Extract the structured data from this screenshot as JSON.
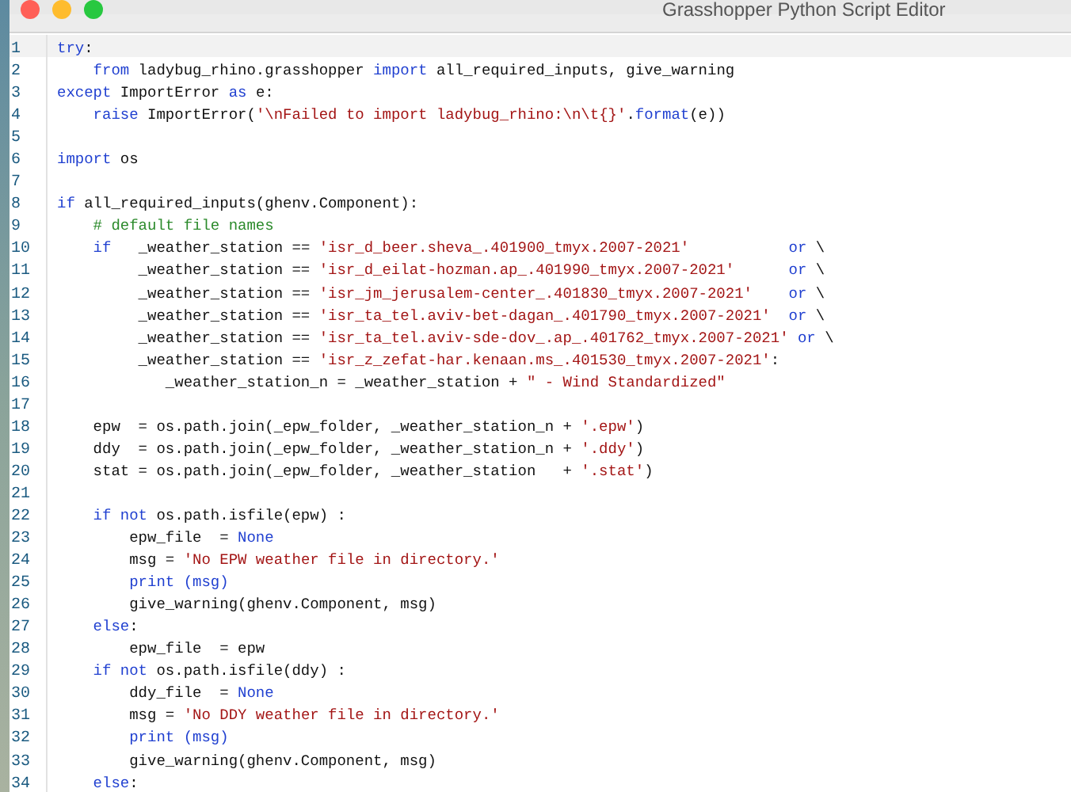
{
  "window": {
    "title": "Grasshopper Python Script Editor"
  },
  "editor": {
    "lines": [
      {
        "number": "1",
        "current": true,
        "tokens": [
          {
            "kind": "kw",
            "text": "try"
          },
          {
            "kind": "plain",
            "text": ":"
          }
        ]
      },
      {
        "number": "2",
        "current": false,
        "tokens": [
          {
            "kind": "kw",
            "text": "    from"
          },
          {
            "kind": "plain",
            "text": " ladybug_rhino.grasshopper "
          },
          {
            "kind": "kw",
            "text": "import"
          },
          {
            "kind": "plain",
            "text": " all_required_inputs, give_warning"
          }
        ]
      },
      {
        "number": "3",
        "current": false,
        "tokens": [
          {
            "kind": "kw",
            "text": "except"
          },
          {
            "kind": "plain",
            "text": " ImportError "
          },
          {
            "kind": "kw",
            "text": "as"
          },
          {
            "kind": "plain",
            "text": " e:"
          }
        ]
      },
      {
        "number": "4",
        "current": false,
        "tokens": [
          {
            "kind": "kw",
            "text": "    raise"
          },
          {
            "kind": "plain",
            "text": " ImportError("
          },
          {
            "kind": "str",
            "text": "'\\nFailed to import ladybug_rhino:\\n\\t{}'"
          },
          {
            "kind": "plain",
            "text": "."
          },
          {
            "kind": "kw",
            "text": "format"
          },
          {
            "kind": "plain",
            "text": "(e))"
          }
        ]
      },
      {
        "number": "5",
        "current": false
      },
      {
        "number": "6",
        "current": false,
        "tokens": [
          {
            "kind": "kw",
            "text": "import"
          },
          {
            "kind": "plain",
            "text": " os"
          }
        ]
      },
      {
        "number": "7",
        "current": false
      },
      {
        "number": "8",
        "current": false,
        "tokens": [
          {
            "kind": "kw",
            "text": "if"
          },
          {
            "kind": "plain",
            "text": " all_required_inputs(ghenv.Component):"
          }
        ]
      },
      {
        "number": "9",
        "current": false,
        "tokens": [
          {
            "kind": "com",
            "text": "    # default file names"
          }
        ]
      },
      {
        "number": "10",
        "current": false,
        "tokens": [
          {
            "kind": "kw",
            "text": "    if"
          },
          {
            "kind": "plain",
            "text": "   _weather_station == "
          },
          {
            "kind": "str",
            "text": "'isr_d_beer.sheva_.401900_tmyx.2007-2021'"
          },
          {
            "kind": "kw",
            "text": "           or"
          },
          {
            "kind": "plain",
            "text": " \\"
          }
        ]
      },
      {
        "number": "11",
        "current": false,
        "tokens": [
          {
            "kind": "plain",
            "text": "         _weather_station == "
          },
          {
            "kind": "str",
            "text": "'isr_d_eilat-hozman.ap_.401990_tmyx.2007-2021'"
          },
          {
            "kind": "kw",
            "text": "      or"
          },
          {
            "kind": "plain",
            "text": " \\"
          }
        ]
      },
      {
        "number": "12",
        "current": false,
        "tokens": [
          {
            "kind": "plain",
            "text": "         _weather_station == "
          },
          {
            "kind": "str",
            "text": "'isr_jm_jerusalem-center_.401830_tmyx.2007-2021'"
          },
          {
            "kind": "kw",
            "text": "    or"
          },
          {
            "kind": "plain",
            "text": " \\"
          }
        ]
      },
      {
        "number": "13",
        "current": false,
        "tokens": [
          {
            "kind": "plain",
            "text": "         _weather_station == "
          },
          {
            "kind": "str",
            "text": "'isr_ta_tel.aviv-bet-dagan_.401790_tmyx.2007-2021'"
          },
          {
            "kind": "kw",
            "text": "  or"
          },
          {
            "kind": "plain",
            "text": " \\"
          }
        ]
      },
      {
        "number": "14",
        "current": false,
        "tokens": [
          {
            "kind": "plain",
            "text": "         _weather_station == "
          },
          {
            "kind": "str",
            "text": "'isr_ta_tel.aviv-sde-dov_.ap_.401762_tmyx.2007-2021'"
          },
          {
            "kind": "kw",
            "text": " or"
          },
          {
            "kind": "plain",
            "text": " \\"
          }
        ]
      },
      {
        "number": "15",
        "current": false,
        "tokens": [
          {
            "kind": "plain",
            "text": "         _weather_station == "
          },
          {
            "kind": "str",
            "text": "'isr_z_zefat-har.kenaan.ms_.401530_tmyx.2007-2021'"
          },
          {
            "kind": "plain",
            "text": ":"
          }
        ]
      },
      {
        "number": "16",
        "current": false,
        "tokens": [
          {
            "kind": "plain",
            "text": "            _weather_station_n = _weather_station + "
          },
          {
            "kind": "str",
            "text": "\" - Wind Standardized\""
          }
        ]
      },
      {
        "number": "17",
        "current": false
      },
      {
        "number": "18",
        "current": false,
        "tokens": [
          {
            "kind": "plain",
            "text": "    epw  = os.path.join(_epw_folder, _weather_station_n + "
          },
          {
            "kind": "str",
            "text": "'.epw'"
          },
          {
            "kind": "plain",
            "text": ")"
          }
        ]
      },
      {
        "number": "19",
        "current": false,
        "tokens": [
          {
            "kind": "plain",
            "text": "    ddy  = os.path.join(_epw_folder, _weather_station_n + "
          },
          {
            "kind": "str",
            "text": "'.ddy'"
          },
          {
            "kind": "plain",
            "text": ")"
          }
        ]
      },
      {
        "number": "20",
        "current": false,
        "tokens": [
          {
            "kind": "plain",
            "text": "    stat = os.path.join(_epw_folder, _weather_station   + "
          },
          {
            "kind": "str",
            "text": "'.stat'"
          },
          {
            "kind": "plain",
            "text": ")"
          }
        ]
      },
      {
        "number": "21",
        "current": false
      },
      {
        "number": "22",
        "current": false,
        "tokens": [
          {
            "kind": "kw",
            "text": "    if not"
          },
          {
            "kind": "plain",
            "text": " os.path.isfile(epw) :"
          }
        ]
      },
      {
        "number": "23",
        "current": false,
        "tokens": [
          {
            "kind": "plain",
            "text": "        epw_file  = "
          },
          {
            "kind": "kw",
            "text": "None"
          }
        ]
      },
      {
        "number": "24",
        "current": false,
        "tokens": [
          {
            "kind": "plain",
            "text": "        msg = "
          },
          {
            "kind": "str",
            "text": "'No EPW weather file in directory.'"
          }
        ]
      },
      {
        "number": "25",
        "current": false,
        "tokens": [
          {
            "kind": "kw",
            "text": "        print (msg)"
          }
        ]
      },
      {
        "number": "26",
        "current": false,
        "tokens": [
          {
            "kind": "plain",
            "text": "        give_warning(ghenv.Component, msg)"
          }
        ]
      },
      {
        "number": "27",
        "current": false,
        "tokens": [
          {
            "kind": "kw",
            "text": "    else"
          },
          {
            "kind": "plain",
            "text": ":"
          }
        ]
      },
      {
        "number": "28",
        "current": false,
        "tokens": [
          {
            "kind": "plain",
            "text": "        epw_file  = epw"
          }
        ]
      },
      {
        "number": "29",
        "current": false,
        "tokens": [
          {
            "kind": "kw",
            "text": "    if not"
          },
          {
            "kind": "plain",
            "text": " os.path.isfile(ddy) :"
          }
        ]
      },
      {
        "number": "30",
        "current": false,
        "tokens": [
          {
            "kind": "plain",
            "text": "        ddy_file  = "
          },
          {
            "kind": "kw",
            "text": "None"
          }
        ]
      },
      {
        "number": "31",
        "current": false,
        "tokens": [
          {
            "kind": "plain",
            "text": "        msg = "
          },
          {
            "kind": "str",
            "text": "'No DDY weather file in directory.'"
          }
        ]
      },
      {
        "number": "32",
        "current": false,
        "tokens": [
          {
            "kind": "kw",
            "text": "        print (msg)"
          }
        ]
      },
      {
        "number": "33",
        "current": false,
        "tokens": [
          {
            "kind": "plain",
            "text": "        give_warning(ghenv.Component, msg)"
          }
        ]
      },
      {
        "number": "34",
        "current": false,
        "tokens": [
          {
            "kind": "kw",
            "text": "    else"
          },
          {
            "kind": "plain",
            "text": ":"
          }
        ]
      }
    ]
  }
}
